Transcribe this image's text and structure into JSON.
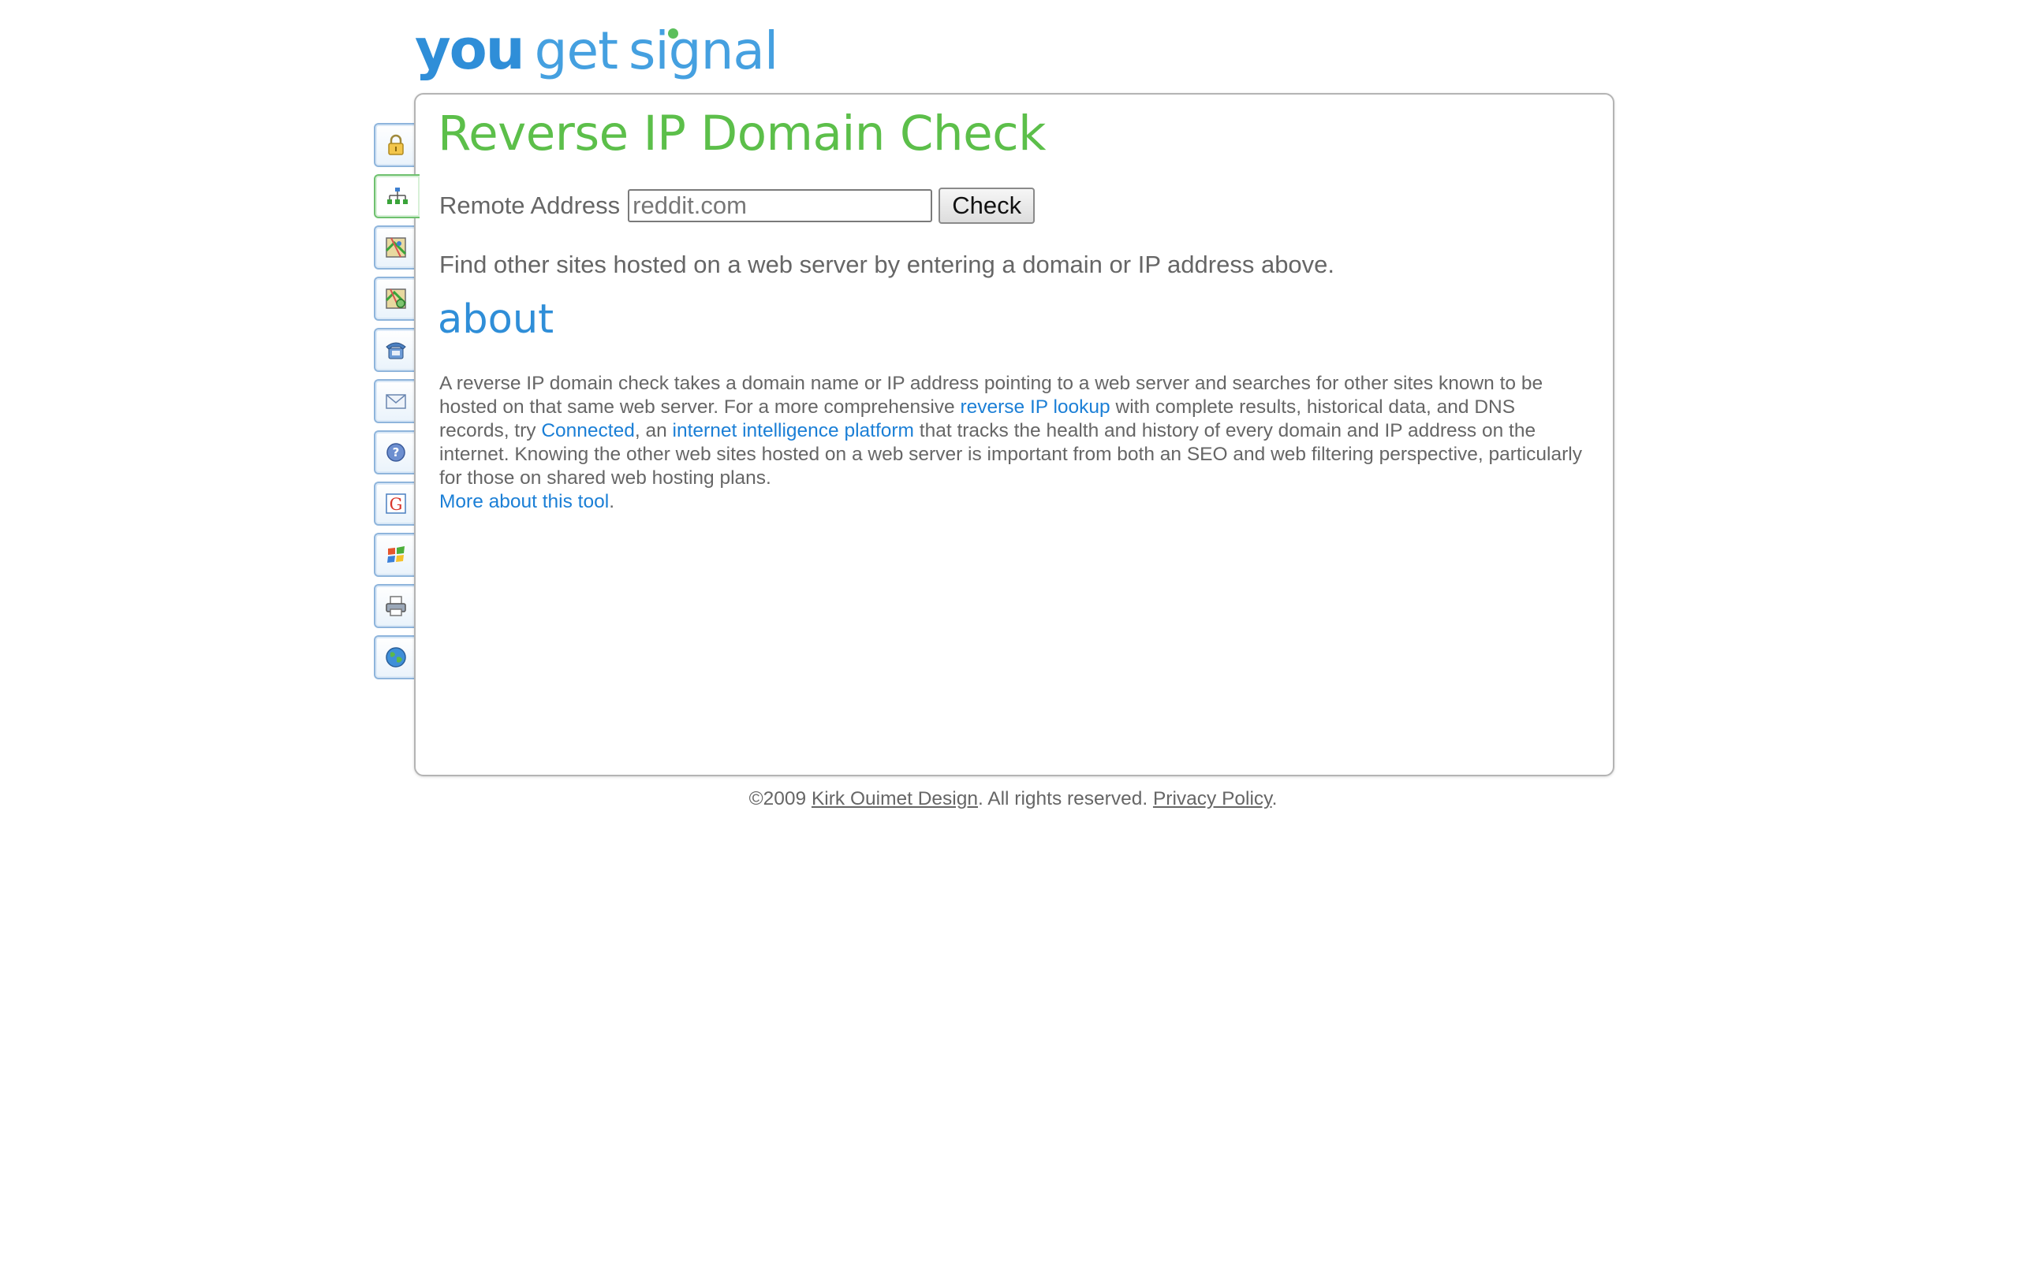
{
  "logo": {
    "word1": "you",
    "word2": "get",
    "word3": "signal"
  },
  "side_tabs": [
    {
      "icon": "lock-icon",
      "active": false
    },
    {
      "icon": "network-icon",
      "active": true
    },
    {
      "icon": "map-icon",
      "active": false
    },
    {
      "icon": "map-search-icon",
      "active": false
    },
    {
      "icon": "phone-icon",
      "active": false
    },
    {
      "icon": "mail-icon",
      "active": false
    },
    {
      "icon": "help-icon",
      "active": false
    },
    {
      "icon": "google-icon",
      "active": false
    },
    {
      "icon": "windows-icon",
      "active": false
    },
    {
      "icon": "printer-icon",
      "active": false
    },
    {
      "icon": "globe-icon",
      "active": false
    }
  ],
  "main": {
    "title": "Reverse IP Domain Check",
    "form": {
      "label": "Remote Address",
      "input_value": "reddit.com",
      "button_label": "Check"
    },
    "intro": "Find other sites hosted on a web server by entering a domain or IP address above.",
    "about_heading": "about",
    "about": {
      "t1": "A reverse IP domain check takes a domain name or IP address pointing to a web server and searches for other sites known to be hosted on that same web server. For a more comprehensive ",
      "link1": "reverse IP lookup",
      "t2": " with complete results, historical data, and DNS records, try ",
      "link2": "Connected",
      "t3": ", an ",
      "link3": "internet intelligence platform",
      "t4": " that tracks the health and history of every domain and IP address on the internet. Knowing the other web sites hosted on a web server is important from both an SEO and web filtering perspective, particularly for those on shared web hosting plans."
    },
    "more_link": "More about this tool",
    "more_suffix": "."
  },
  "footer": {
    "copyright": "©2009 ",
    "company_link": "Kirk Ouimet Design",
    "rights": ". All rights reserved. ",
    "privacy_link": "Privacy Policy",
    "end": "."
  },
  "colors": {
    "title_green": "#5cbf4a",
    "link_blue": "#1b7fd6",
    "heading_blue": "#2f8ed8",
    "body_text": "#666666"
  }
}
